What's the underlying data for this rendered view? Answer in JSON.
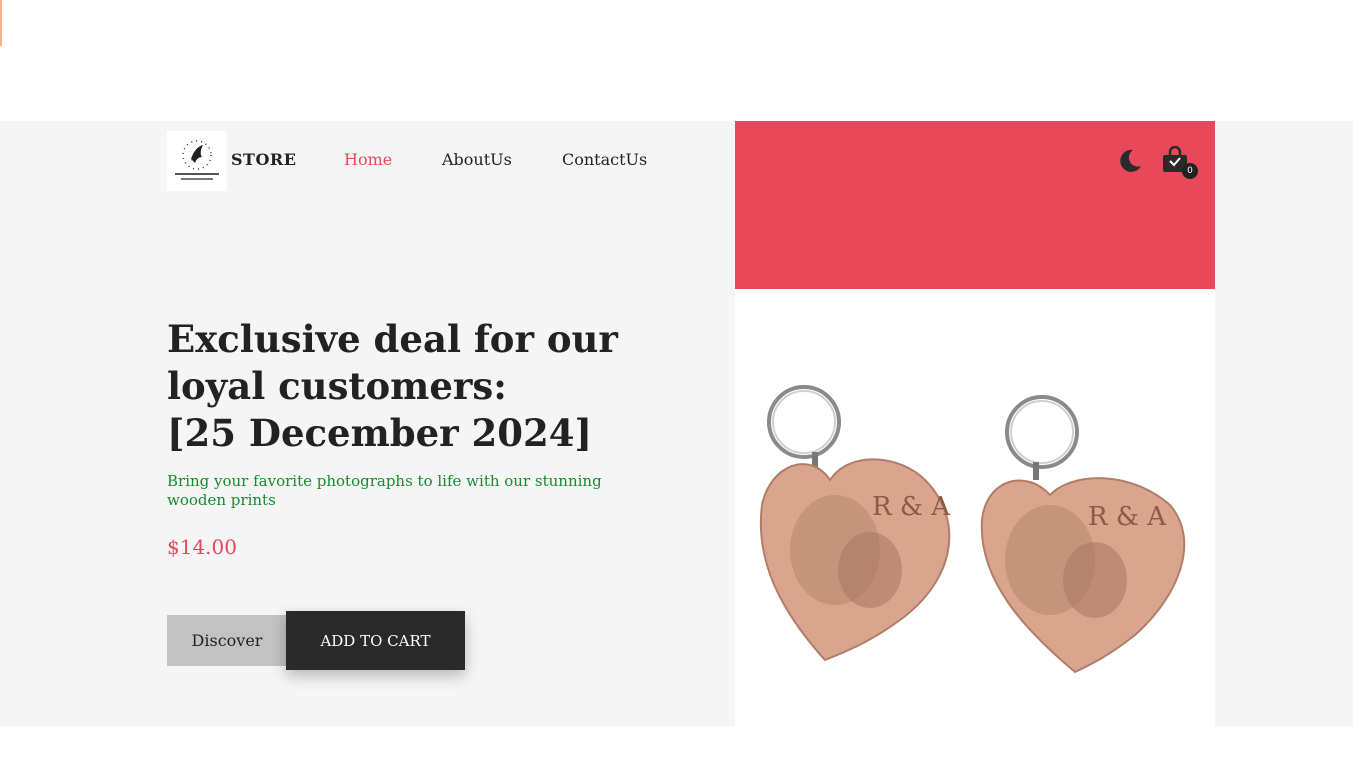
{
  "brand": {
    "name": "STORE"
  },
  "nav": {
    "items": [
      {
        "label": "Home",
        "active": true
      },
      {
        "label": "AboutUs",
        "active": false
      },
      {
        "label": "ContactUs",
        "active": false
      }
    ]
  },
  "header": {
    "theme_toggle_icon": "moon-icon",
    "cart_icon": "shopping-bag-icon",
    "cart_count": "0"
  },
  "hero": {
    "headline_line1": "Exclusive deal for our",
    "headline_line2": "loyal customers:",
    "headline_line3": "[25 December 2024]",
    "subtitle": "Bring your favorite photographs to life with our stunning wooden prints",
    "price": "$14.00",
    "discover_label": "Discover",
    "add_to_cart_label": "ADD TO CART",
    "product_tag_left": "R & A",
    "product_tag_right": "R & A"
  },
  "colors": {
    "accent": "#e8495a",
    "subtitle": "#1a8a2e",
    "dark": "#2a2a2a"
  }
}
